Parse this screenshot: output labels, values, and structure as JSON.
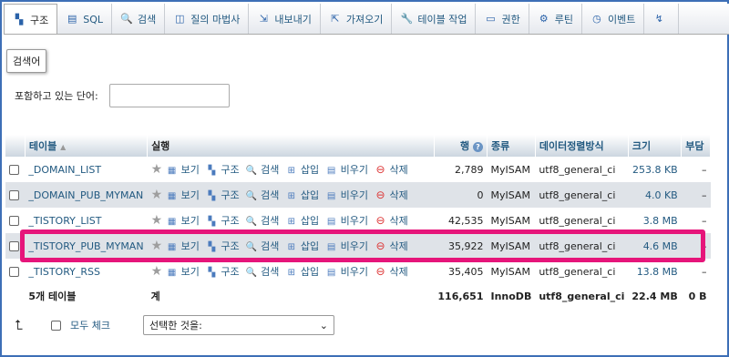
{
  "tabs": [
    {
      "label": "구조",
      "icon": "structure-icon",
      "glyph": "▚"
    },
    {
      "label": "SQL",
      "icon": "sql-icon",
      "glyph": "▤"
    },
    {
      "label": "검색",
      "icon": "search-icon",
      "glyph": "🔍"
    },
    {
      "label": "질의 마법사",
      "icon": "query-icon",
      "glyph": "◫"
    },
    {
      "label": "내보내기",
      "icon": "export-icon",
      "glyph": "⇲"
    },
    {
      "label": "가져오기",
      "icon": "import-icon",
      "glyph": "⇱"
    },
    {
      "label": "테이블 작업",
      "icon": "wrench-icon",
      "glyph": "🔧"
    },
    {
      "label": "권한",
      "icon": "privileges-icon",
      "glyph": "▭"
    },
    {
      "label": "루틴",
      "icon": "routines-icon",
      "glyph": "⚙"
    },
    {
      "label": "이벤트",
      "icon": "clock-icon",
      "glyph": "◷"
    },
    {
      "label": "",
      "icon": "triggers-icon",
      "glyph": "↯"
    }
  ],
  "tooltip": "검색어",
  "filter": {
    "label": "포함하고 있는 단어:",
    "value": ""
  },
  "table": {
    "headers": {
      "table": "테이블",
      "sort": "▲",
      "action": "실행",
      "rows": "행",
      "help": "?",
      "type": "종류",
      "collation": "데이터정렬방식",
      "size": "크기",
      "overhead": "부담"
    },
    "actions": {
      "browse": "보기",
      "structure": "구조",
      "search": "검색",
      "insert": "삽입",
      "empty": "비우기",
      "drop": "삭제"
    },
    "rows": [
      {
        "name": "_DOMAIN_LIST",
        "rows": "2,789",
        "type": "MyISAM",
        "collation": "utf8_general_ci",
        "size": "253.8 KB",
        "overhead": "–"
      },
      {
        "name": "_DOMAIN_PUB_MYMAN",
        "rows": "0",
        "type": "MyISAM",
        "collation": "utf8_general_ci",
        "size": "4.0 KB",
        "overhead": "–"
      },
      {
        "name": "_TISTORY_LIST",
        "rows": "42,535",
        "type": "MyISAM",
        "collation": "utf8_general_ci",
        "size": "3.8 MB",
        "overhead": "–"
      },
      {
        "name": "_TISTORY_PUB_MYMAN",
        "rows": "35,922",
        "type": "MyISAM",
        "collation": "utf8_general_ci",
        "size": "4.6 MB",
        "overhead": "–"
      },
      {
        "name": "_TISTORY_RSS",
        "rows": "35,405",
        "type": "MyISAM",
        "collation": "utf8_general_ci",
        "size": "13.8 MB",
        "overhead": "–"
      }
    ],
    "footer": {
      "count": "5개 테이블",
      "sum": "계",
      "rows": "116,651",
      "type": "InnoDB",
      "collation": "utf8_general_ci",
      "size": "22.4 MB",
      "overhead": "0 B"
    }
  },
  "bottom": {
    "arrow": "⮤",
    "check_all": "모두 체크",
    "select": "선택한 것을:",
    "caret": "⌄"
  },
  "colors": {
    "highlight": "#e6157a",
    "link": "#235a81"
  }
}
